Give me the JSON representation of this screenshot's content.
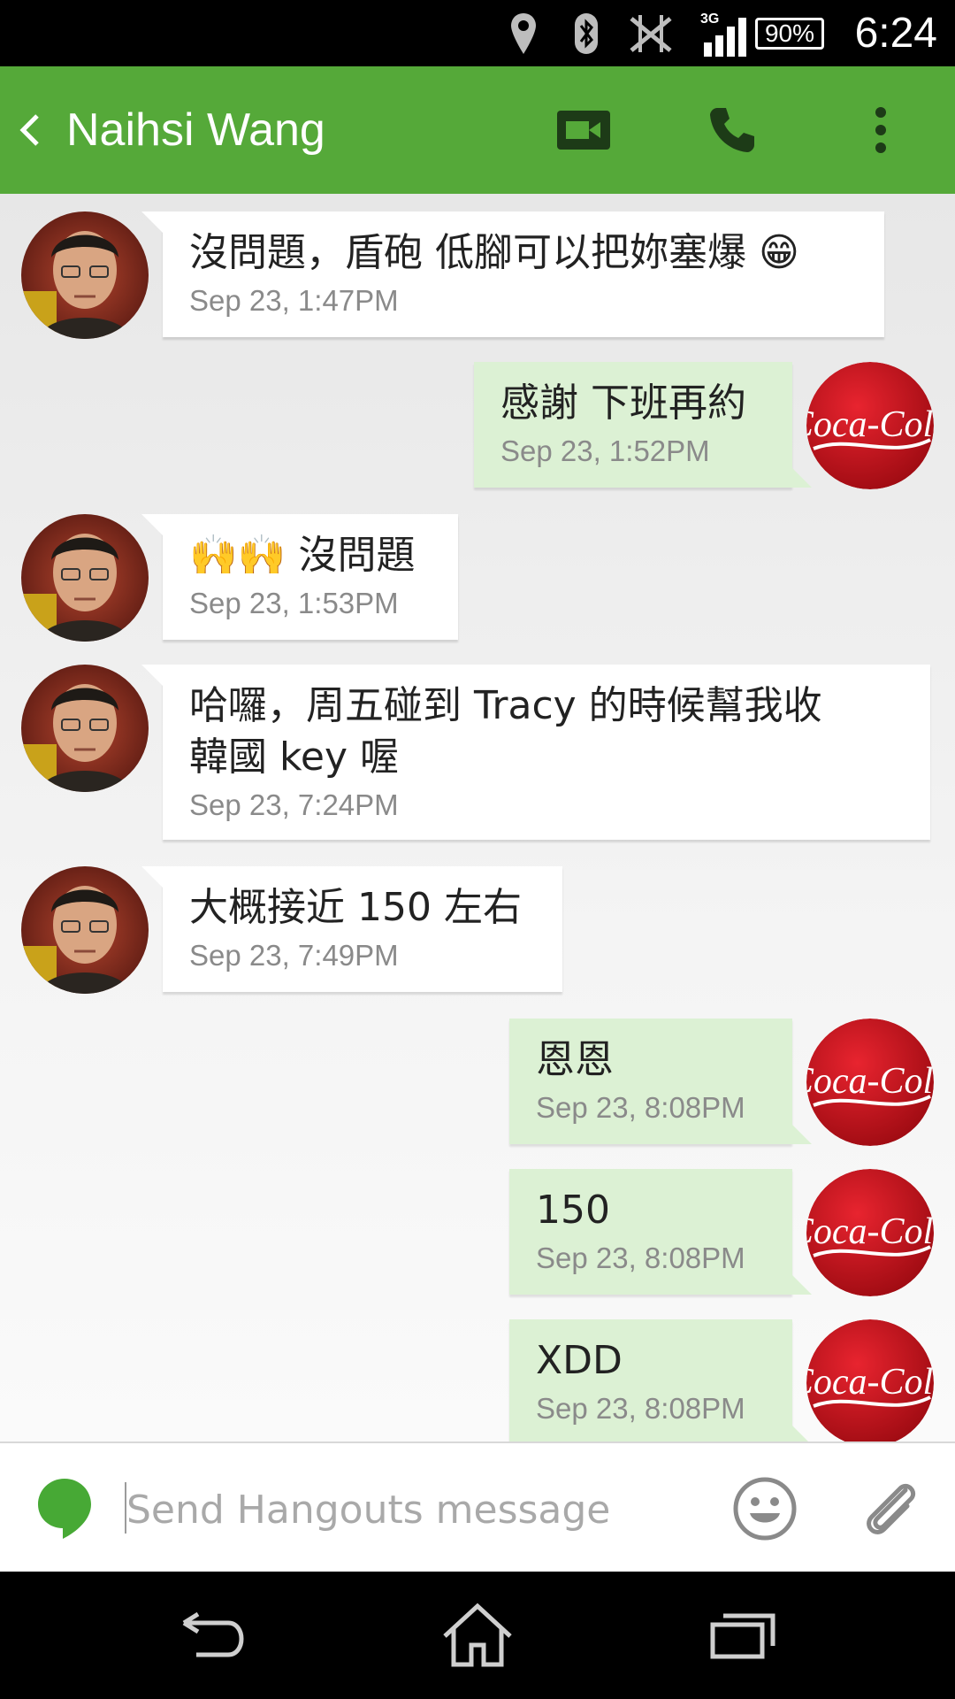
{
  "status_bar": {
    "network": "3G",
    "battery": "90%",
    "time": "6:24",
    "icons": [
      "location-icon",
      "bluetooth-icon",
      "nfc-icon",
      "signal-icon"
    ]
  },
  "app_bar": {
    "title": "Naihsi Wang",
    "color": "#55a939"
  },
  "messages": [
    {
      "side": "in",
      "text": "沒問題，盾砲 低腳可以把妳塞爆 😁",
      "time": "Sep 23, 1:47PM"
    },
    {
      "side": "out",
      "text": "感謝 下班再約",
      "time": "Sep 23, 1:52PM"
    },
    {
      "side": "in",
      "text": "🙌🙌 沒問題",
      "time": "Sep 23, 1:53PM"
    },
    {
      "side": "in",
      "text": "哈囉，周五碰到 Tracy 的時候幫我收\n韓國 key 喔",
      "time": "Sep 23, 7:24PM"
    },
    {
      "side": "in",
      "text": "大概接近 150 左右",
      "time": "Sep 23, 7:49PM"
    },
    {
      "side": "out",
      "text": "恩恩",
      "time": "Sep 23, 8:08PM"
    },
    {
      "side": "out",
      "text": "150",
      "time": "Sep 23, 8:08PM"
    },
    {
      "side": "out",
      "text": "XDD",
      "time": "Sep 23, 8:08PM"
    }
  ],
  "compose": {
    "placeholder": "Send Hangouts message"
  }
}
